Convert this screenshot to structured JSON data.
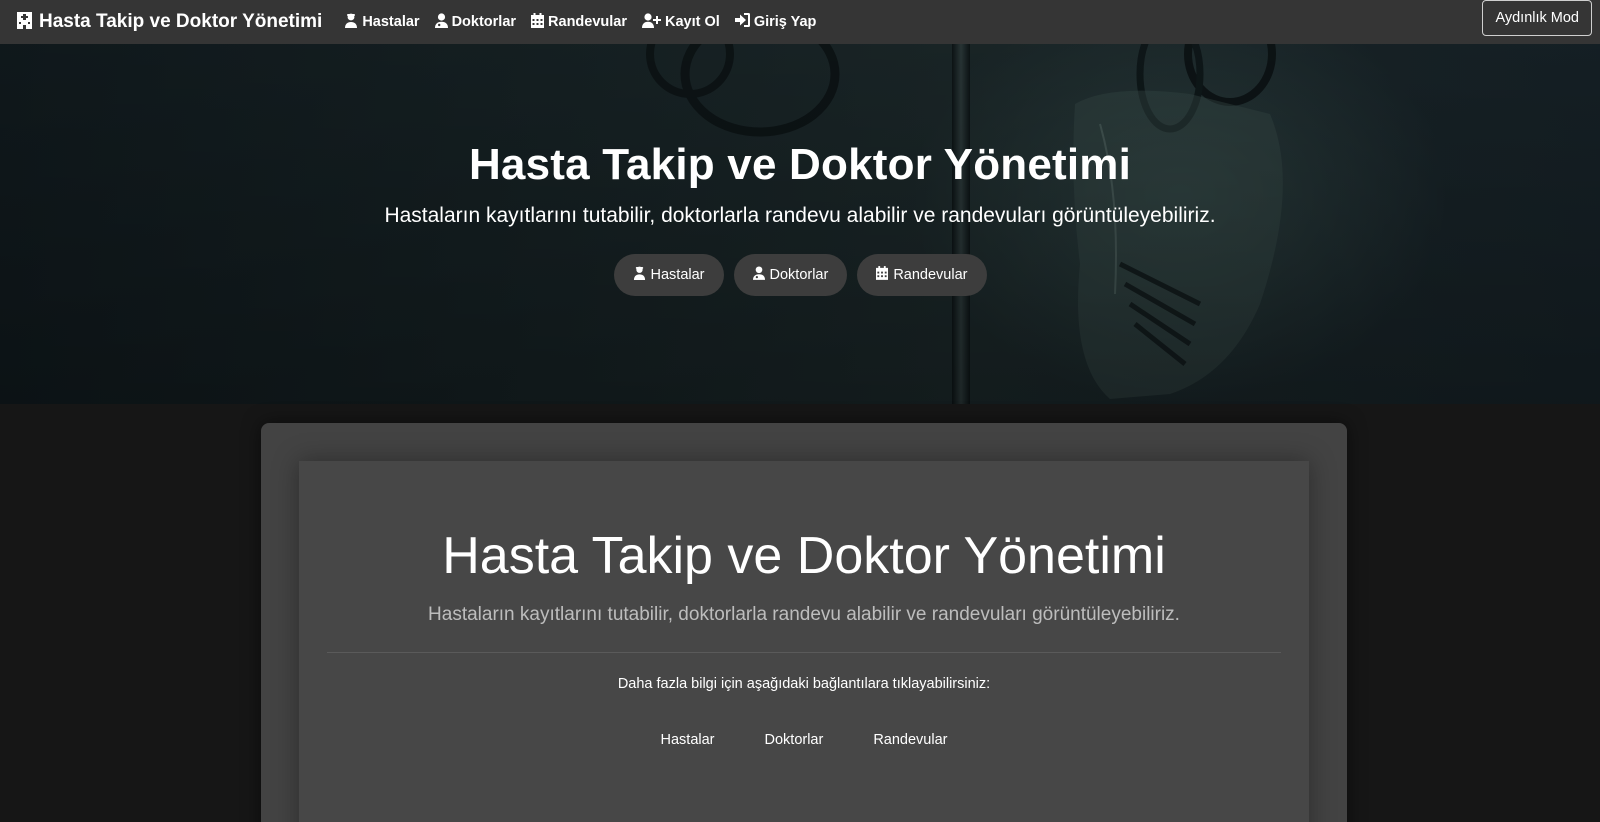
{
  "navbar": {
    "brand": "Hasta Takip ve Doktor Yönetimi",
    "links": [
      {
        "label": "Hastalar",
        "icon": "user-injured-icon"
      },
      {
        "label": "Doktorlar",
        "icon": "user-doctor-icon"
      },
      {
        "label": "Randevular",
        "icon": "calendar-icon"
      },
      {
        "label": "Kayıt Ol",
        "icon": "user-plus-icon"
      },
      {
        "label": "Giriş Yap",
        "icon": "sign-in-icon"
      }
    ],
    "mode_toggle": "Aydınlık Mod"
  },
  "hero": {
    "title": "Hasta Takip ve Doktor Yönetimi",
    "subtitle": "Hastaların kayıtlarını tutabilir, doktorlarla randevu alabilir ve randevuları görüntüleyebiliriz.",
    "buttons": [
      {
        "label": "Hastalar",
        "icon": "user-injured-icon"
      },
      {
        "label": "Doktorlar",
        "icon": "user-doctor-icon"
      },
      {
        "label": "Randevular",
        "icon": "calendar-icon"
      }
    ]
  },
  "card": {
    "title": "Hasta Takip ve Doktor Yönetimi",
    "subtitle": "Hastaların kayıtlarını tutabilir, doktorlarla randevu alabilir ve randevuları görüntüleyebiliriz.",
    "info": "Daha fazla bilgi için aşağıdaki bağlantılara tıklayabilirsiniz:",
    "links": [
      "Hastalar",
      "Doktorlar",
      "Randevular"
    ]
  },
  "colors": {
    "navbar_bg": "#353535",
    "page_bg": "#161616",
    "card_bg": "#434343",
    "pill_bg": "#3d3d3d"
  }
}
